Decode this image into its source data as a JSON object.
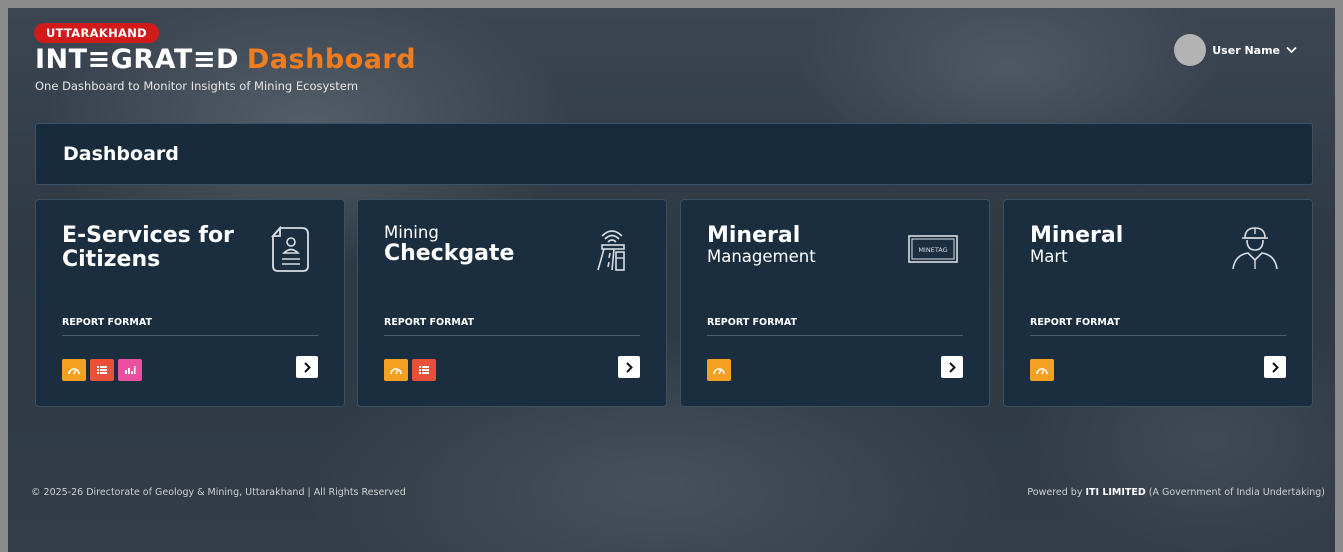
{
  "header": {
    "state_badge": "UTTARAKHAND",
    "brand_main": "INT≡GRAT≡D",
    "brand_accent": "Dashboard",
    "tagline": "One Dashboard to Monitor Insights of Mining Ecosystem",
    "user_name": "User Name"
  },
  "page": {
    "title": "Dashboard"
  },
  "cards": [
    {
      "title_prefix": "",
      "title_line1": "E-Services for",
      "title_line2": "Citizens",
      "icon": "citizen-document-icon",
      "report_label": "REPORT FORMAT",
      "report_icons": [
        "dashboard-icon",
        "list-icon",
        "chart-icon"
      ]
    },
    {
      "title_prefix": "Mining",
      "title_line1": "Checkgate",
      "title_line2": "",
      "icon": "checkgate-icon",
      "report_label": "REPORT FORMAT",
      "report_icons": [
        "dashboard-icon",
        "list-icon"
      ]
    },
    {
      "title_prefix": "",
      "title_line1": "Mineral",
      "title_line2": "Management",
      "icon": "minetag-icon",
      "icon_text": "MINETAG",
      "report_label": "REPORT FORMAT",
      "report_icons": [
        "dashboard-icon"
      ]
    },
    {
      "title_prefix": "",
      "title_line1": "Mineral",
      "title_line2": "Mart",
      "icon": "worker-icon",
      "report_label": "REPORT FORMAT",
      "report_icons": [
        "dashboard-icon"
      ]
    }
  ],
  "footer": {
    "left": "© 2025-26 Directorate of Geology & Mining, Uttarakhand | All Rights Reserved",
    "right_prefix": "Powered by ",
    "right_bold": "ITI LIMITED",
    "right_suffix": " (A Government of India Undertaking)"
  },
  "colors": {
    "badge": "#d11a1a",
    "accent": "#f07c1e",
    "card_bg": "#1b2e40",
    "orange_icon": "#f4a020",
    "red_icon": "#e9503a",
    "pink_icon": "#ea4fa0"
  }
}
